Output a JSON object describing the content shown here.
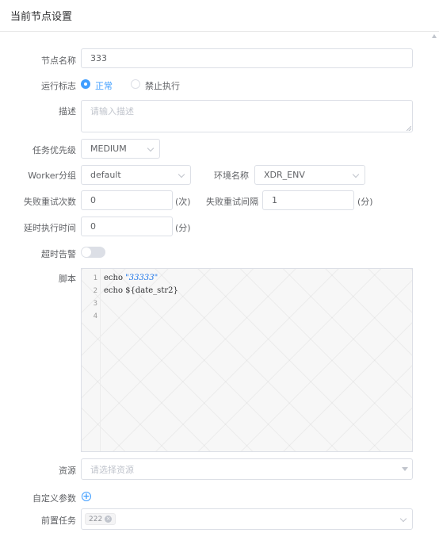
{
  "panel": {
    "title": "当前节点设置"
  },
  "form": {
    "node_name": {
      "label": "节点名称",
      "value": "333"
    },
    "run_flag": {
      "label": "运行标志",
      "options": [
        {
          "label": "正常",
          "checked": true
        },
        {
          "label": "禁止执行",
          "checked": false
        }
      ]
    },
    "description": {
      "label": "描述",
      "placeholder": "请输入描述"
    },
    "priority": {
      "label": "任务优先级",
      "value": "MEDIUM"
    },
    "worker_group": {
      "label": "Worker分组",
      "value": "default"
    },
    "environment": {
      "label": "环境名称",
      "value": "XDR_ENV"
    },
    "retry_times": {
      "label": "失败重试次数",
      "value": "0",
      "unit": "(次)"
    },
    "retry_interval": {
      "label": "失败重试间隔",
      "value": "1",
      "unit": "(分)"
    },
    "delay_time": {
      "label": "延时执行时间",
      "value": "0",
      "unit": "(分)"
    },
    "timeout_alarm": {
      "label": "超时告警",
      "enabled": false
    },
    "script": {
      "label": "脚本",
      "lines": [
        {
          "no": "1",
          "code": "echo ",
          "string": "\"33333\""
        },
        {
          "no": "2",
          "code": "echo ${date_str2}",
          "string": ""
        },
        {
          "no": "3",
          "code": "",
          "string": ""
        },
        {
          "no": "4",
          "code": "",
          "string": ""
        }
      ]
    },
    "resource": {
      "label": "资源",
      "placeholder": "请选择资源"
    },
    "custom_params": {
      "label": "自定义参数"
    },
    "pre_tasks": {
      "label": "前置任务",
      "tags": [
        "222"
      ]
    }
  },
  "colors": {
    "accent": "#409eff",
    "string": "#1a73e8",
    "border": "#dcdfe6"
  },
  "icons": [
    "chevron-down-icon",
    "caret-down-icon",
    "plus-circle-icon",
    "close-icon"
  ]
}
